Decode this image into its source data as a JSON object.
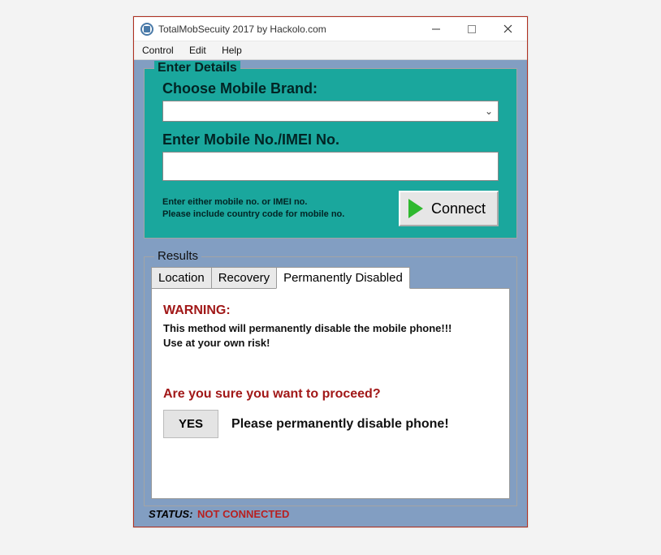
{
  "window": {
    "title": "TotalMobSecuity 2017 by Hackolo.com"
  },
  "menu": {
    "control": "Control",
    "edit": "Edit",
    "help": "Help"
  },
  "details": {
    "panel_title": "Enter Details",
    "brand_label": "Choose Mobile Brand:",
    "brand_value": "",
    "imei_label": "Enter Mobile No./IMEI No.",
    "imei_value": "",
    "hint_line1": "Enter either mobile no. or IMEI no.",
    "hint_line2": "Please include country code for mobile no.",
    "connect_label": "Connect"
  },
  "results": {
    "panel_title": "Results",
    "tabs": {
      "location": "Location",
      "recovery": "Recovery",
      "disabled": "Permanently Disabled"
    },
    "warning_head": "WARNING:",
    "warning_body1": "This method will permanently disable the mobile phone!!!",
    "warning_body2": "Use at your own risk!",
    "proceed_question": "Are you sure you want to proceed?",
    "yes_label": "YES",
    "proceed_msg": "Please permanently disable phone!"
  },
  "status": {
    "label": "STATUS:",
    "value": "NOT CONNECTED"
  }
}
